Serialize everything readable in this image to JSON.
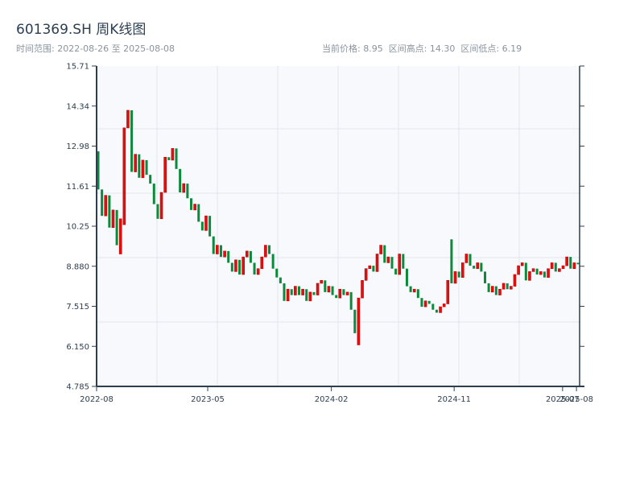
{
  "header": {
    "title": "601369.SH 周K线图",
    "range_text": "时间范围: 2022-08-26 至 2025-08-08",
    "stats_text": "当前价格: 8.95  区间高点: 14.30  区间低点: 6.19"
  },
  "chart_data": {
    "type": "candlestick",
    "title": "601369.SH 周K线图",
    "date_range": [
      "2022-08-26",
      "2025-08-08"
    ],
    "ylim": [
      4.785,
      15.71
    ],
    "y_ticks": [
      "15.71",
      "14.34",
      "12.98",
      "11.61",
      "10.25",
      "8.880",
      "7.515",
      "6.150",
      "4.785"
    ],
    "x_ticks": [
      "2022-08",
      "2023-05",
      "2024-02",
      "2024-11",
      "2025-07",
      "2025-08"
    ],
    "grid": true,
    "colors": {
      "up": "#e01010",
      "down": "#0b8a3c",
      "plot_bg": "#f7f9fc",
      "axis": "#2c3e50"
    },
    "open": [
      12.8,
      11.5,
      10.6,
      11.3,
      10.2,
      10.8,
      9.3,
      10.3,
      13.6,
      14.2,
      12.1,
      12.7,
      11.9,
      12.5,
      12.0,
      11.7,
      11.0,
      10.5,
      11.4,
      12.6,
      12.5,
      12.9,
      12.2,
      11.4,
      11.7,
      11.2,
      10.8,
      11.0,
      10.4,
      10.1,
      10.6,
      9.9,
      9.3,
      9.6,
      9.2,
      9.4,
      9.0,
      8.7,
      9.1,
      8.6,
      9.2,
      9.4,
      9.0,
      8.6,
      8.8,
      9.2,
      9.6,
      9.3,
      8.8,
      8.5,
      8.3,
      7.7,
      8.1,
      7.9,
      8.2,
      7.9,
      8.1,
      7.7,
      8.0,
      7.9,
      8.3,
      8.4,
      8.0,
      8.2,
      7.9,
      7.8,
      8.1,
      7.9,
      8.0,
      7.4,
      6.2,
      7.8,
      8.4,
      8.8,
      8.9,
      8.7,
      9.3,
      9.6,
      9.0,
      9.2,
      8.8,
      8.6,
      9.3,
      8.8,
      8.2,
      8.0,
      8.1,
      7.8,
      7.5,
      7.7,
      7.6,
      7.4,
      7.3,
      7.5,
      7.6,
      9.8,
      8.3,
      8.7,
      8.5,
      9.0,
      9.3,
      8.9,
      8.8,
      9.0,
      8.7,
      8.3,
      8.0,
      8.2,
      7.9,
      8.1,
      8.3,
      8.1,
      8.2,
      8.6,
      8.9,
      9.0,
      8.4,
      8.7,
      8.8,
      8.6,
      8.7,
      8.5,
      8.8,
      9.0,
      8.7,
      8.8,
      8.9,
      9.2,
      8.8,
      9.0
    ],
    "close": [
      11.5,
      10.6,
      11.3,
      10.2,
      10.8,
      9.6,
      10.5,
      13.6,
      14.2,
      12.1,
      12.7,
      11.9,
      12.5,
      12.0,
      11.7,
      11.0,
      10.5,
      11.4,
      12.6,
      12.5,
      12.9,
      12.2,
      11.4,
      11.7,
      11.2,
      10.8,
      11.0,
      10.4,
      10.1,
      10.6,
      9.9,
      9.3,
      9.6,
      9.2,
      9.4,
      9.0,
      8.7,
      9.1,
      8.6,
      9.2,
      9.4,
      9.0,
      8.6,
      8.8,
      9.2,
      9.6,
      9.3,
      8.8,
      8.5,
      8.3,
      7.7,
      8.1,
      7.9,
      8.2,
      7.9,
      8.1,
      7.7,
      8.0,
      7.9,
      8.3,
      8.4,
      8.0,
      8.2,
      7.9,
      7.8,
      8.1,
      7.9,
      8.0,
      7.4,
      6.6,
      7.8,
      8.4,
      8.8,
      8.9,
      8.7,
      9.3,
      9.6,
      9.0,
      9.2,
      8.8,
      8.6,
      9.3,
      8.8,
      8.2,
      8.0,
      8.1,
      7.8,
      7.5,
      7.7,
      7.6,
      7.4,
      7.3,
      7.5,
      7.6,
      8.4,
      8.3,
      8.7,
      8.5,
      9.0,
      9.3,
      8.9,
      8.8,
      9.0,
      8.7,
      8.3,
      8.0,
      8.2,
      7.9,
      8.1,
      8.3,
      8.1,
      8.2,
      8.6,
      8.9,
      9.0,
      8.4,
      8.7,
      8.8,
      8.6,
      8.7,
      8.5,
      8.8,
      9.0,
      8.7,
      8.8,
      8.9,
      9.2,
      8.8,
      9.0,
      8.95
    ]
  }
}
